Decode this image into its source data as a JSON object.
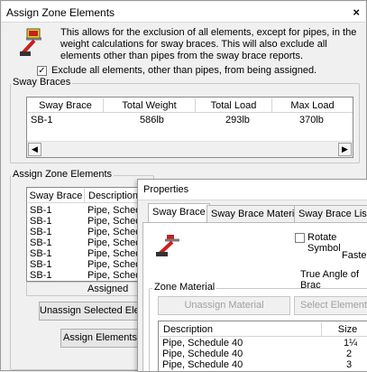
{
  "dialog": {
    "title": "Assign Zone Elements",
    "close_label": "×",
    "info_text": "This allows for the exclusion of all elements, except for pipes, in the weight calculations for sway braces. This will also exclude all elements other than pipes from the sway brace reports.",
    "exclude_checkbox": {
      "checked_mark": "✓",
      "label": "Exclude all elements, other than pipes, from being assigned."
    }
  },
  "sway_braces": {
    "group_label": "Sway Braces",
    "columns": [
      "Sway Brace",
      "Total Weight",
      "Total Load",
      "Max Load"
    ],
    "rows": [
      [
        "SB-1",
        "586lb",
        "293lb",
        "370lb"
      ]
    ]
  },
  "assign_zone": {
    "group_label": "Assign Zone Elements",
    "columns": [
      "Sway Brace",
      "Description"
    ],
    "rows": [
      [
        "SB-1",
        "Pipe, Sched"
      ],
      [
        "SB-1",
        "Pipe, Sched"
      ],
      [
        "SB-1",
        "Pipe, Sched"
      ],
      [
        "SB-1",
        "Pipe, Sched"
      ],
      [
        "SB-1",
        "Pipe, Sched"
      ],
      [
        "SB-1",
        "Pipe, Sched"
      ],
      [
        "SB-1",
        "Pipe, Sched"
      ]
    ],
    "assigned_label": "Assigned",
    "unassign_button": "Unassign Selected Eler",
    "assign_button": "Assign Elements"
  },
  "properties": {
    "title": "Properties",
    "tabs": [
      "Sway Brace",
      "Sway Brace Material",
      "Sway Brace Listing"
    ],
    "rotate_symbol_label": "Rotate Symbol",
    "fasten_label": "Faster",
    "true_angle_label": "True Angle of Brac",
    "zone_material": {
      "group_label": "Zone Material",
      "unassign_button": "Unassign Material",
      "select_button": "Select Elements in",
      "columns": [
        "Description",
        "Size"
      ],
      "rows": [
        [
          "Pipe, Schedule 40",
          "1¼"
        ],
        [
          "Pipe, Schedule 40",
          "2"
        ],
        [
          "Pipe, Schedule 40",
          "3"
        ]
      ]
    }
  },
  "scroll": {
    "left_arrow": "◀",
    "right_arrow": "▶"
  }
}
